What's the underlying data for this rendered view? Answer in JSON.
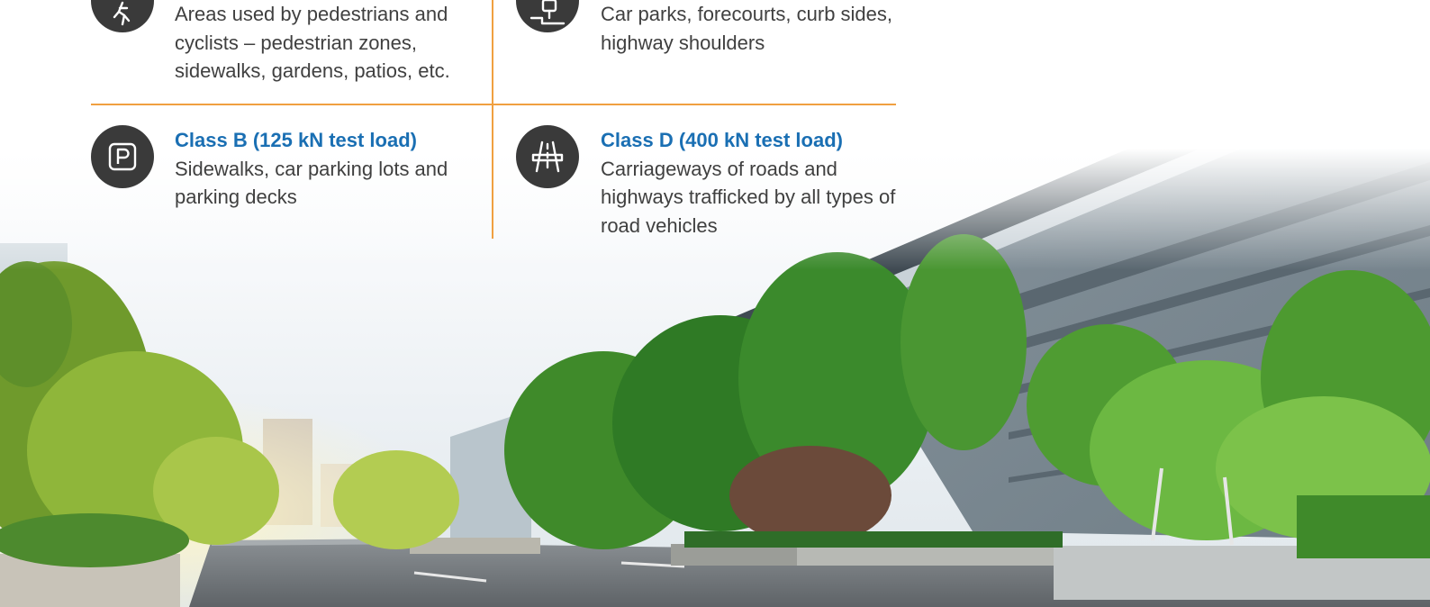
{
  "classes": [
    {
      "id": "class-a",
      "title": "",
      "description": "Areas used by pedestrians and cyclists – pedestrian zones, sidewalks, gardens, patios, etc.",
      "icon": "pedestrian-icon"
    },
    {
      "id": "class-c",
      "title": "",
      "description": "Car parks, forecourts, curb sides, highway shoulders",
      "icon": "curb-parking-icon"
    },
    {
      "id": "class-b",
      "title": "Class B (125 kN test load)",
      "description": "Sidewalks, car parking lots and parking decks",
      "icon": "parking-icon"
    },
    {
      "id": "class-d",
      "title": "Class D (400 kN test load)",
      "description": "Carriageways of roads and highways trafficked by all types of road vehicles",
      "icon": "highway-icon"
    }
  ],
  "colors": {
    "title_blue": "#1a6fb3",
    "divider_orange": "#f0a040",
    "icon_dark": "#3a3a3a",
    "body_text": "#404040"
  }
}
